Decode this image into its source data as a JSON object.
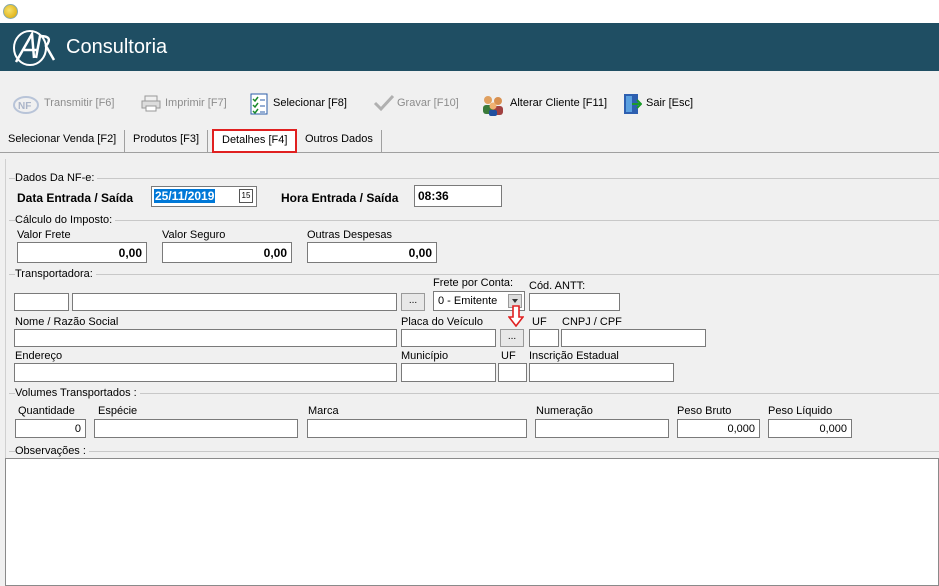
{
  "brand": {
    "name": "Consultoria"
  },
  "toolbar": {
    "transmitir": "Transmitir [F6]",
    "imprimir": "Imprimir  [F7]",
    "selecionar": "Selecionar [F8]",
    "gravar": "Gravar [F10]",
    "alterar_cliente": "Alterar Cliente [F11]",
    "sair": "Sair   [Esc]"
  },
  "tabs": [
    {
      "label": "Selecionar Venda [F2]"
    },
    {
      "label": "Produtos [F3]"
    },
    {
      "label": "Detalhes [F4]"
    },
    {
      "label": "Outros Dados"
    }
  ],
  "nfe": {
    "group": "Dados Da NF-e:",
    "data_label": "Data Entrada / Saída",
    "data_value": "25/11/2019",
    "hora_label": "Hora Entrada / Saída",
    "hora_value": "08:36"
  },
  "imposto": {
    "group": "Cálculo do Imposto:",
    "frete_label": "Valor Frete",
    "frete_value": "0,00",
    "seguro_label": "Valor Seguro",
    "seguro_value": "0,00",
    "despesas_label": "Outras Despesas",
    "despesas_value": "0,00"
  },
  "transportadora": {
    "group": "Transportadora:",
    "frete_conta_label": "Frete por Conta:",
    "frete_conta_value": "0 - Emitente",
    "antt_label": "Cód. ANTT:",
    "nome_label": "Nome / Razão Social",
    "placa_label": "Placa do Veículo",
    "uf_label": "UF",
    "cnpj_label": "CNPJ / CPF",
    "endereco_label": "Endereço",
    "municipio_label": "Município",
    "uf2_label": "UF",
    "ie_label": "Inscrição Estadual",
    "ellipsis": "..."
  },
  "volumes": {
    "group": "Volumes Transportados :",
    "quantidade_label": "Quantidade",
    "quantidade_value": "0",
    "especie_label": "Espécie",
    "marca_label": "Marca",
    "numeracao_label": "Numeração",
    "peso_bruto_label": "Peso Bruto",
    "peso_bruto_value": "0,000",
    "peso_liquido_label": "Peso Líquido",
    "peso_liquido_value": "0,000"
  },
  "observacoes": {
    "label": "Observações :"
  },
  "colors": {
    "banner": "#1f4e63",
    "highlight": "#e02020",
    "selection": "#0078d7"
  }
}
